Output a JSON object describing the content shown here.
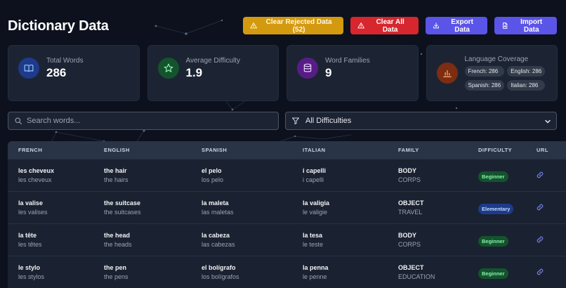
{
  "header": {
    "title": "Dictionary Data",
    "buttons": {
      "clear_rejected": "Clear Rejected Data (52)",
      "clear_all": "Clear All Data",
      "export": "Export Data",
      "import": "Import Data"
    }
  },
  "stats": {
    "total_words": {
      "label": "Total Words",
      "value": "286",
      "icon": "book-icon"
    },
    "avg_difficulty": {
      "label": "Average Difficulty",
      "value": "1.9",
      "icon": "star-icon"
    },
    "word_families": {
      "label": "Word Families",
      "value": "9",
      "icon": "database-icon"
    },
    "language_coverage": {
      "label": "Language Coverage",
      "icon": "bar-chart-icon",
      "badges": [
        "French: 286",
        "English: 286",
        "Spanish: 286",
        "Italian: 286"
      ]
    }
  },
  "search": {
    "placeholder": "Search words..."
  },
  "filter": {
    "label": "All Difficulties"
  },
  "table": {
    "headers": [
      "FRENCH",
      "ENGLISH",
      "SPANISH",
      "ITALIAN",
      "FAMILY",
      "DIFFICULTY",
      "URL"
    ],
    "rows": [
      {
        "fr": "les cheveux",
        "fr_pl": "les cheveux",
        "en": "the hair",
        "en_pl": "the hairs",
        "es": "el pelo",
        "es_pl": "los pelo",
        "it": "i capelli",
        "it_pl": "i capelli",
        "family": "BODY",
        "family_fr": "CORPS",
        "difficulty": "Beginner"
      },
      {
        "fr": "la valise",
        "fr_pl": "les valises",
        "en": "the suitcase",
        "en_pl": "the suitcases",
        "es": "la maleta",
        "es_pl": "las maletas",
        "it": "la valigia",
        "it_pl": "le valigie",
        "family": "OBJECT",
        "family_fr": "TRAVEL",
        "difficulty": "Elementary"
      },
      {
        "fr": "la tête",
        "fr_pl": "les têtes",
        "en": "the head",
        "en_pl": "the heads",
        "es": "la cabeza",
        "es_pl": "las cabezas",
        "it": "la tesa",
        "it_pl": "le teste",
        "family": "BODY",
        "family_fr": "CORPS",
        "difficulty": "Beginner"
      },
      {
        "fr": "le stylo",
        "fr_pl": "les stylos",
        "en": "the pen",
        "en_pl": "the pens",
        "es": "el bolígrafo",
        "es_pl": "los bolígrafos",
        "it": "la penna",
        "it_pl": "le penne",
        "family": "OBJECT",
        "family_fr": "EDUCATION",
        "difficulty": "Beginner"
      }
    ]
  },
  "colors": {
    "background": "#0c111d",
    "card": "#1c2434",
    "warning": "#d49a0f",
    "danger": "#d7262e",
    "primary": "#5b54e8",
    "beginner_badge": "#14532d",
    "elementary_badge": "#1e3a8a"
  }
}
